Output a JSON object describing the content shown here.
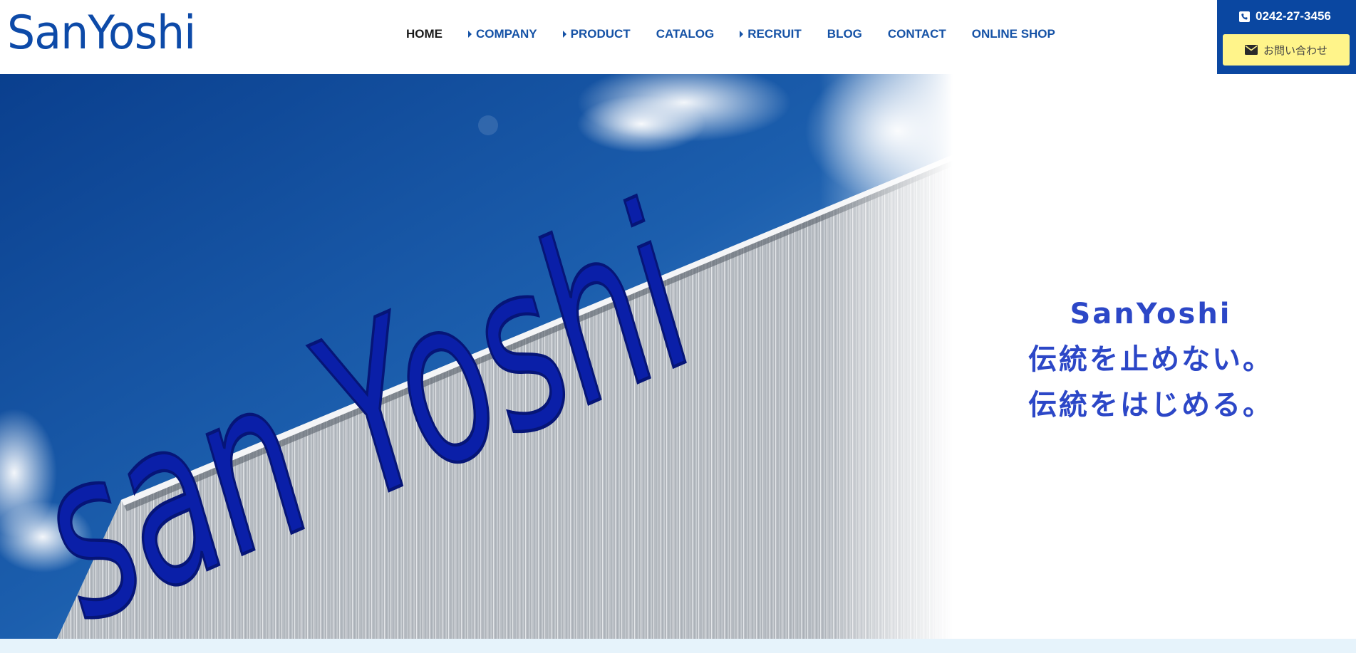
{
  "header": {
    "logo_text": "SanYoshi",
    "nav": [
      {
        "label": "HOME",
        "active": true,
        "caret": false
      },
      {
        "label": "COMPANY",
        "active": false,
        "caret": true
      },
      {
        "label": "PRODUCT",
        "active": false,
        "caret": true
      },
      {
        "label": "CATALOG",
        "active": false,
        "caret": false
      },
      {
        "label": "RECRUIT",
        "active": false,
        "caret": true
      },
      {
        "label": "BLOG",
        "active": false,
        "caret": false
      },
      {
        "label": "CONTACT",
        "active": false,
        "caret": false
      },
      {
        "label": "ONLINE SHOP",
        "active": false,
        "caret": false
      }
    ]
  },
  "contact": {
    "phone": "0242-27-3456",
    "phone_icon": "phone-square-icon",
    "inquiry_label": "お問い合わせ",
    "inquiry_icon": "envelope-icon"
  },
  "hero": {
    "sign_text": "san Yoshi",
    "catch_line1": "SanYoshi",
    "catch_line2": "伝統を止めない。",
    "catch_line3": "伝統をはじめる。"
  },
  "colors": {
    "brand_blue": "#0d4aa8",
    "nav_blue": "#1552a6",
    "contact_bg": "#0a47a1",
    "inquiry_bg": "#fff48a",
    "catch_blue": "#2c47c7"
  }
}
